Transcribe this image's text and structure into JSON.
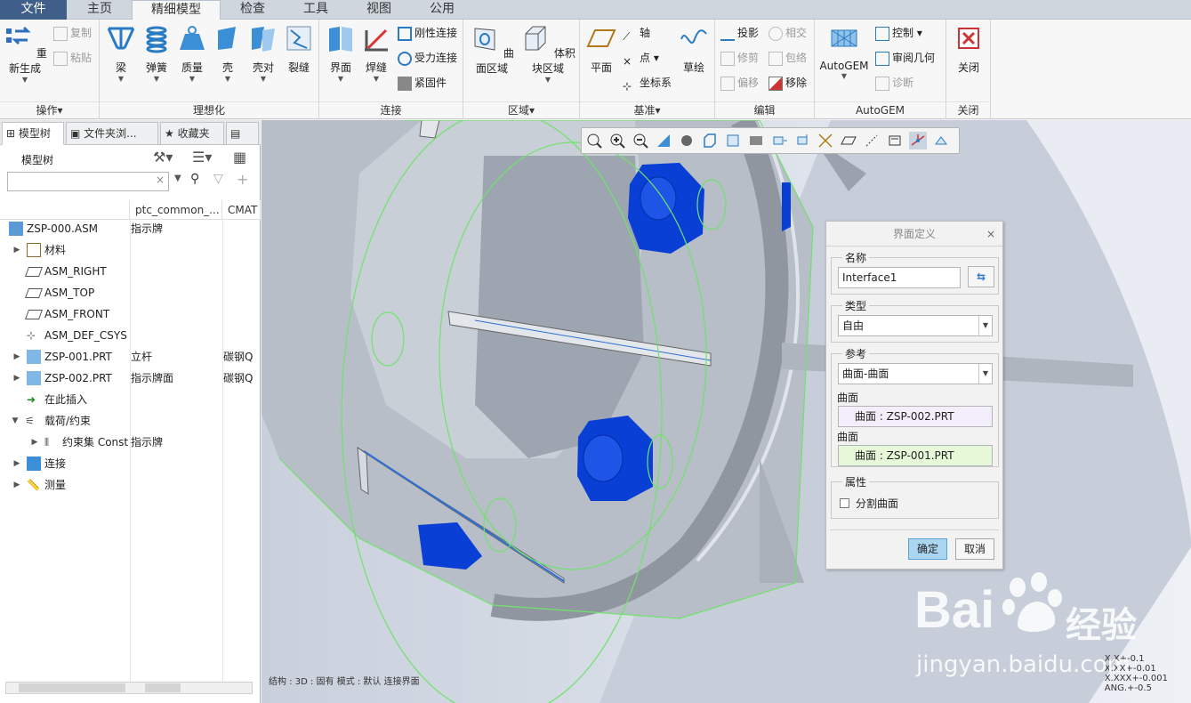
{
  "tabs": [
    "文件",
    "主页",
    "精细模型",
    "检查",
    "工具",
    "视图",
    "公用"
  ],
  "ribbon": {
    "groups": {
      "operations": "操作▾",
      "idealization": "理想化",
      "connection": "连接",
      "region": "区域▾",
      "datum": "基准▾",
      "edit": "编辑",
      "autogem": "AutoGEM",
      "close": "关闭"
    },
    "buttons": {
      "regenerate": "重新生成",
      "copy": "复制",
      "paste": "粘贴",
      "beam": "梁",
      "spring": "弹簧",
      "mass": "质量",
      "shell": "壳",
      "shell_pair": "壳对",
      "crack": "裂缝",
      "interface": "界面",
      "weld": "焊缝",
      "rigid_link": "刚性连接",
      "weighted_link": "受力连接",
      "fastener": "紧固件",
      "surface_region": "曲面区域",
      "volume_region": "体积块区域",
      "plane": "平面",
      "axis": "轴",
      "point": "点",
      "csys": "坐标系",
      "sketch": "草绘",
      "project": "投影",
      "intersect": "相交",
      "trim": "修剪",
      "wrap": "包络",
      "offset": "偏移",
      "remove": "移除",
      "autogem": "AutoGEM",
      "control": "控制",
      "review_geometry": "审阅几何",
      "diagnose": "诊断",
      "close": "关闭"
    }
  },
  "panel": {
    "tabs": [
      "模型树",
      "文件夹浏...",
      "收藏夹"
    ],
    "tree_title": "模型树",
    "search_value": "",
    "columns": [
      "ptc_common_...",
      "CMAT"
    ],
    "rows": [
      {
        "label": "ZSP-000.ASM",
        "c2": "指示牌",
        "c3": ""
      },
      {
        "label": "材料",
        "c2": "",
        "c3": ""
      },
      {
        "label": "ASM_RIGHT",
        "c2": "",
        "c3": ""
      },
      {
        "label": "ASM_TOP",
        "c2": "",
        "c3": ""
      },
      {
        "label": "ASM_FRONT",
        "c2": "",
        "c3": ""
      },
      {
        "label": "ASM_DEF_CSYS",
        "c2": "",
        "c3": ""
      },
      {
        "label": "ZSP-001.PRT",
        "c2": "立杆",
        "c3": "碳钢Q"
      },
      {
        "label": "ZSP-002.PRT",
        "c2": "指示牌面",
        "c3": "碳钢Q"
      },
      {
        "label": "在此插入",
        "c2": "",
        "c3": ""
      },
      {
        "label": "载荷/约束",
        "c2": "",
        "c3": ""
      },
      {
        "label": "约束集 Const",
        "c2": "指示牌",
        "c3": ""
      },
      {
        "label": "连接",
        "c2": "",
        "c3": ""
      },
      {
        "label": "测量",
        "c2": "",
        "c3": ""
      }
    ]
  },
  "dialog": {
    "title": "界面定义",
    "name_legend": "名称",
    "name_value": "Interface1",
    "type_legend": "类型",
    "type_value": "自由",
    "ref_legend": "参考",
    "ref_value": "曲面-曲面",
    "surface1_label": "曲面",
    "surface1_value": "曲面 : ZSP-002.PRT",
    "surface2_label": "曲面",
    "surface2_value": "曲面 : ZSP-001.PRT",
    "props_legend": "属性",
    "split_surface": "分割曲面",
    "ok": "确定",
    "cancel": "取消"
  },
  "status": {
    "line": "结构 : 3D : 固有 模式 : 默认 连接界面",
    "coords": [
      "X.X+-0.1",
      "X.XX+-0.01",
      "X.XXX+-0.001",
      "ANG.+-0.5"
    ]
  },
  "watermark": {
    "brand": "Bai",
    "brand_cn": "经验",
    "url": "jingyan.baidu.com"
  },
  "colors": {
    "accent": "#3f5f8a",
    "bolt": "#0a3fd6",
    "highlight": "#6fe36a"
  }
}
